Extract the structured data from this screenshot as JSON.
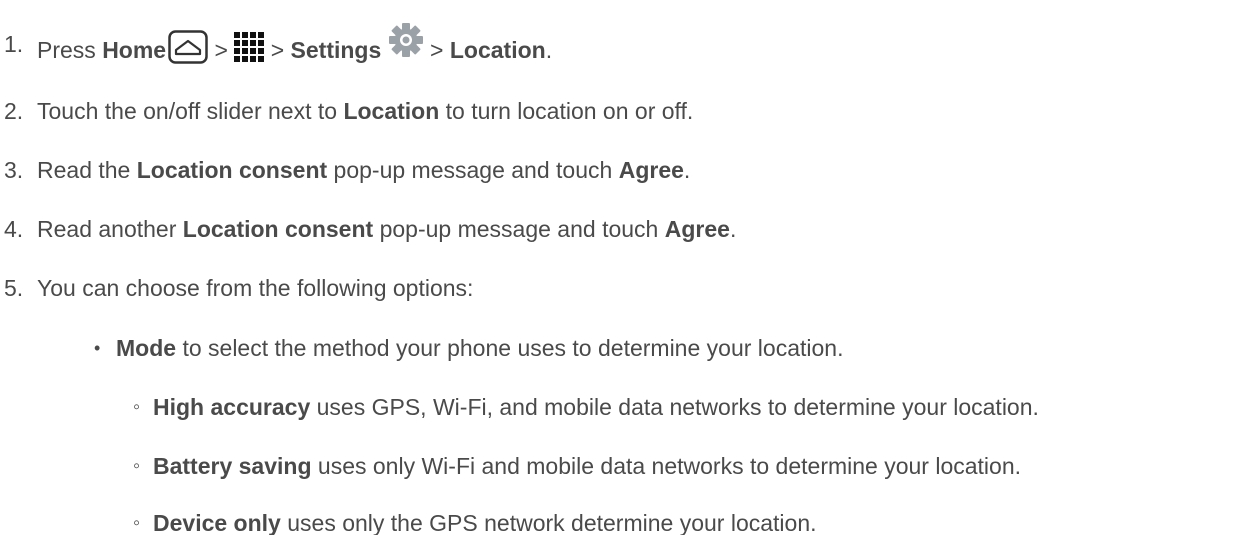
{
  "steps": [
    {
      "number": "1.",
      "parts": {
        "press": "Press",
        "home": "Home",
        "sep1": ">",
        "sep2": ">",
        "settings": "Settings",
        "sep3": ">",
        "location": "Location",
        "end": "."
      },
      "icons": [
        "home-button-icon",
        "apps-grid-icon",
        "settings-gear-icon"
      ]
    },
    {
      "number": "2.",
      "pre": "Touch the on/off slider next to",
      "bold": "Location",
      "post": "to turn location on or off."
    },
    {
      "number": "3.",
      "pre": "Read the",
      "bold1": "Location consent",
      "mid": "pop-up message and touch",
      "bold2": "Agree",
      "end": "."
    },
    {
      "number": "4.",
      "pre": "Read another",
      "bold1": "Location consent",
      "mid": "pop-up message and touch",
      "bold2": "Agree",
      "end": "."
    },
    {
      "number": "5.",
      "text": "You can choose from the following options:"
    }
  ],
  "options": {
    "mode": {
      "bullet": "•",
      "bold": "Mode",
      "text": "to select the method your phone uses to determine your location."
    },
    "sub": [
      {
        "bullet": "◦",
        "bold": "High accuracy",
        "text": "uses GPS, Wi-Fi, and mobile data networks to determine your location."
      },
      {
        "bullet": "◦",
        "bold": "Battery saving",
        "text": "uses only Wi-Fi and mobile data networks to determine your location."
      },
      {
        "bullet": "◦",
        "bold": "Device only",
        "text": "uses only the GPS network determine your location."
      }
    ]
  },
  "colors": {
    "text": "#4a4a4a",
    "gear": "#9aa2a8"
  }
}
